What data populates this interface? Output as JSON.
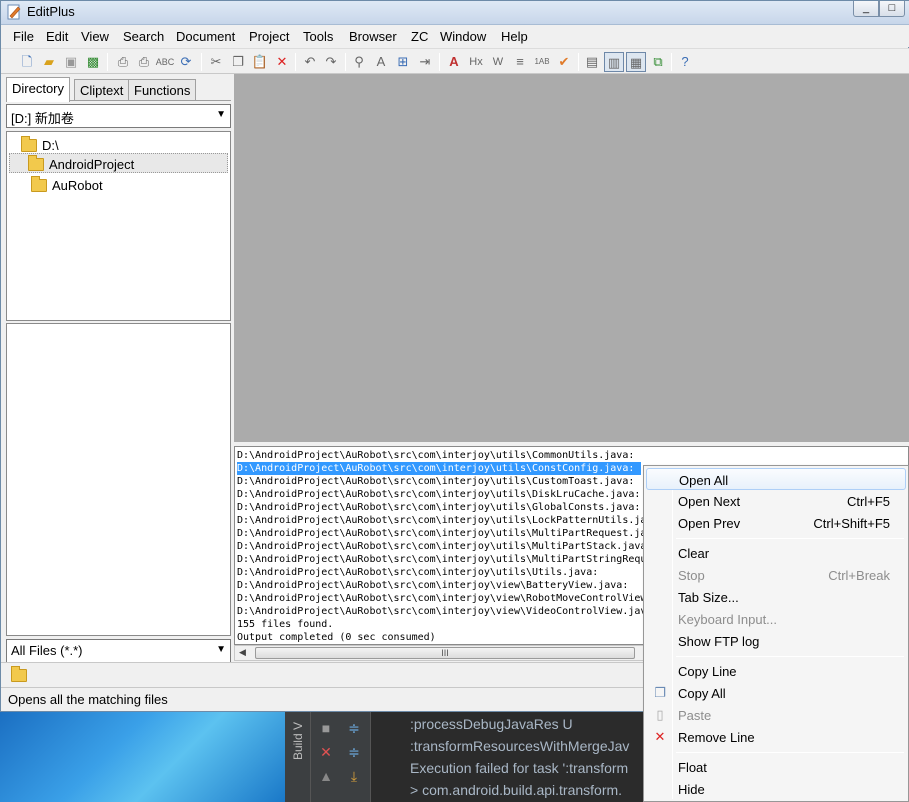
{
  "window": {
    "title": "EditPlus",
    "minimize": "_",
    "maximize": "□"
  },
  "menu": [
    "File",
    "Edit",
    "View",
    "Search",
    "Document",
    "Project",
    "Tools",
    "Browser",
    "ZC",
    "Window",
    "Help"
  ],
  "toolbar_icons": [
    "new-file-icon",
    "open-icon",
    "save-icon",
    "save-all-icon",
    "print-preview-icon",
    "print-icon",
    "spell-check-icon",
    "check-icon",
    "browser-preview-icon",
    "cut-icon",
    "copy-icon",
    "paste-icon",
    "delete-icon",
    "undo-icon",
    "redo-icon",
    "find-icon",
    "replace-icon",
    "find-in-files-icon",
    "goto-icon",
    "font-icon",
    "heading-icon",
    "word-wrap-icon",
    "indent-icon",
    "line-number-icon",
    "spell-icon",
    "directory-window-icon",
    "cliptext-window-icon",
    "output-window-icon",
    "fullscreen-icon",
    "help-icon"
  ],
  "left_pane": {
    "tabs": [
      "Directory",
      "Cliptext",
      "Functions"
    ],
    "active_tab": "Directory",
    "drive_combo": "[D:] 新加卷",
    "tree": [
      {
        "label": "D:\\",
        "indent": 0,
        "selected": false
      },
      {
        "label": "AndroidProject",
        "indent": 1,
        "selected": true
      },
      {
        "label": "AuRobot",
        "indent": 2,
        "selected": false
      }
    ],
    "filter_combo": "All Files (*.*)"
  },
  "output": {
    "lines": [
      "D:\\AndroidProject\\AuRobot\\src\\com\\interjoy\\utils\\CommonUtils.java:",
      "D:\\AndroidProject\\AuRobot\\src\\com\\interjoy\\utils\\ConstConfig.java:",
      "D:\\AndroidProject\\AuRobot\\src\\com\\interjoy\\utils\\CustomToast.java:",
      "D:\\AndroidProject\\AuRobot\\src\\com\\interjoy\\utils\\DiskLruCache.java:",
      "D:\\AndroidProject\\AuRobot\\src\\com\\interjoy\\utils\\GlobalConsts.java:",
      "D:\\AndroidProject\\AuRobot\\src\\com\\interjoy\\utils\\LockPatternUtils.ja",
      "D:\\AndroidProject\\AuRobot\\src\\com\\interjoy\\utils\\MultiPartRequest.ja",
      "D:\\AndroidProject\\AuRobot\\src\\com\\interjoy\\utils\\MultiPartStack.java",
      "D:\\AndroidProject\\AuRobot\\src\\com\\interjoy\\utils\\MultiPartStringRequ",
      "D:\\AndroidProject\\AuRobot\\src\\com\\interjoy\\utils\\Utils.java:",
      "D:\\AndroidProject\\AuRobot\\src\\com\\interjoy\\view\\BatteryView.java:",
      "D:\\AndroidProject\\AuRobot\\src\\com\\interjoy\\view\\RobotMoveControlView",
      "D:\\AndroidProject\\AuRobot\\src\\com\\interjoy\\view\\VideoControlView.jav",
      "155 files found.",
      "Output completed (0 sec consumed)"
    ],
    "selected_index": 1,
    "scroll_thumb_label": "III"
  },
  "status": "Opens all the matching files",
  "context_menu": {
    "items": [
      {
        "label": "Open All",
        "shortcut": "",
        "disabled": false,
        "highlight": true,
        "icon": ""
      },
      {
        "label": "Open Next",
        "shortcut": "Ctrl+F5",
        "disabled": false,
        "highlight": false,
        "icon": ""
      },
      {
        "label": "Open Prev",
        "shortcut": "Ctrl+Shift+F5",
        "disabled": false,
        "highlight": false,
        "icon": ""
      },
      {
        "sep": true
      },
      {
        "label": "Clear",
        "shortcut": "",
        "disabled": false,
        "highlight": false,
        "icon": ""
      },
      {
        "label": "Stop",
        "shortcut": "Ctrl+Break",
        "disabled": true,
        "highlight": false,
        "icon": ""
      },
      {
        "label": "Tab Size...",
        "shortcut": "",
        "disabled": false,
        "highlight": false,
        "icon": ""
      },
      {
        "label": "Keyboard Input...",
        "shortcut": "",
        "disabled": true,
        "highlight": false,
        "icon": ""
      },
      {
        "label": "Show FTP log",
        "shortcut": "",
        "disabled": false,
        "highlight": false,
        "icon": ""
      },
      {
        "sep": true
      },
      {
        "label": "Copy Line",
        "shortcut": "",
        "disabled": false,
        "highlight": false,
        "icon": ""
      },
      {
        "label": "Copy All",
        "shortcut": "",
        "disabled": false,
        "highlight": false,
        "icon": "copy-icon"
      },
      {
        "label": "Paste",
        "shortcut": "",
        "disabled": true,
        "highlight": false,
        "icon": "paste-icon"
      },
      {
        "label": "Remove Line",
        "shortcut": "",
        "disabled": false,
        "highlight": false,
        "icon": "remove-icon"
      },
      {
        "sep": true
      },
      {
        "label": "Float",
        "shortcut": "",
        "disabled": false,
        "highlight": false,
        "icon": ""
      },
      {
        "label": "Hide",
        "shortcut": "",
        "disabled": false,
        "highlight": false,
        "icon": ""
      }
    ]
  },
  "background_ide": {
    "panel_label": "Build V",
    "lines": [
      ":processDebugJavaRes U",
      ":transformResourcesWithMergeJav",
      "Execution failed for task ':transform",
      "> com.android.build.api.transform."
    ]
  },
  "colors": {
    "selection": "#3399ff",
    "editor_bg": "#ababab",
    "menu_highlight": "#e8f1fb"
  }
}
